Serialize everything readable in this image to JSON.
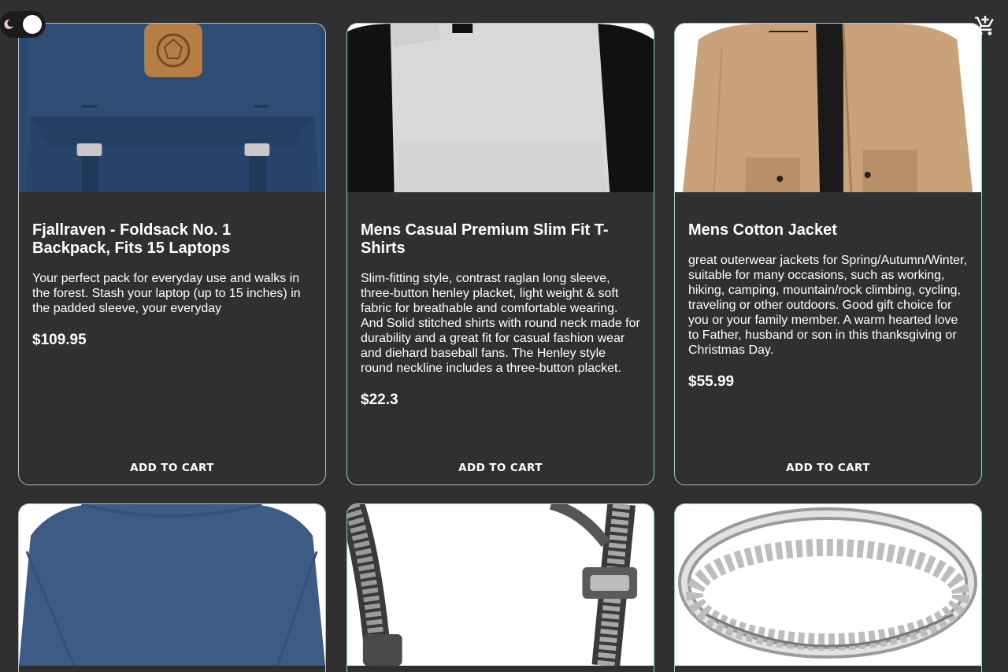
{
  "header": {
    "theme_toggle": {
      "state": "dark",
      "icon": "moon-icon"
    },
    "cart": {
      "icon": "add-shopping-cart-icon"
    }
  },
  "colors": {
    "background": "#303030",
    "card_border": "#9fc7cc",
    "text": "#ffffff"
  },
  "products": [
    {
      "title": "Fjallraven - Foldsack No. 1 Backpack, Fits 15 Laptops",
      "description": "Your perfect pack for everyday use and walks in the forest. Stash your laptop (up to 15 inches) in the padded sleeve, your everyday",
      "price": "$109.95",
      "button_label": "ADD TO CART",
      "image": "backpack-image"
    },
    {
      "title": "Mens Casual Premium Slim Fit T-Shirts",
      "description": "Slim-fitting style, contrast raglan long sleeve, three-button henley placket, light weight & soft fabric for breathable and comfortable wearing. And Solid stitched shirts with round neck made for durability and a great fit for casual fashion wear and diehard baseball fans. The Henley style round neckline includes a three-button placket.",
      "price": "$22.3",
      "button_label": "ADD TO CART",
      "image": "tshirt-image"
    },
    {
      "title": "Mens Cotton Jacket",
      "description": "great outerwear jackets for Spring/Autumn/Winter, suitable for many occasions, such as working, hiking, camping, mountain/rock climbing, cycling, traveling or other outdoors. Good gift choice for you or your family member. A warm hearted love to Father, husband or son in this thanksgiving or Christmas Day.",
      "price": "$55.99",
      "button_label": "ADD TO CART",
      "image": "jacket-image"
    },
    {
      "image": "long-sleeve-shirt-image"
    },
    {
      "image": "chain-bracelet-image"
    },
    {
      "image": "ring-image"
    }
  ]
}
